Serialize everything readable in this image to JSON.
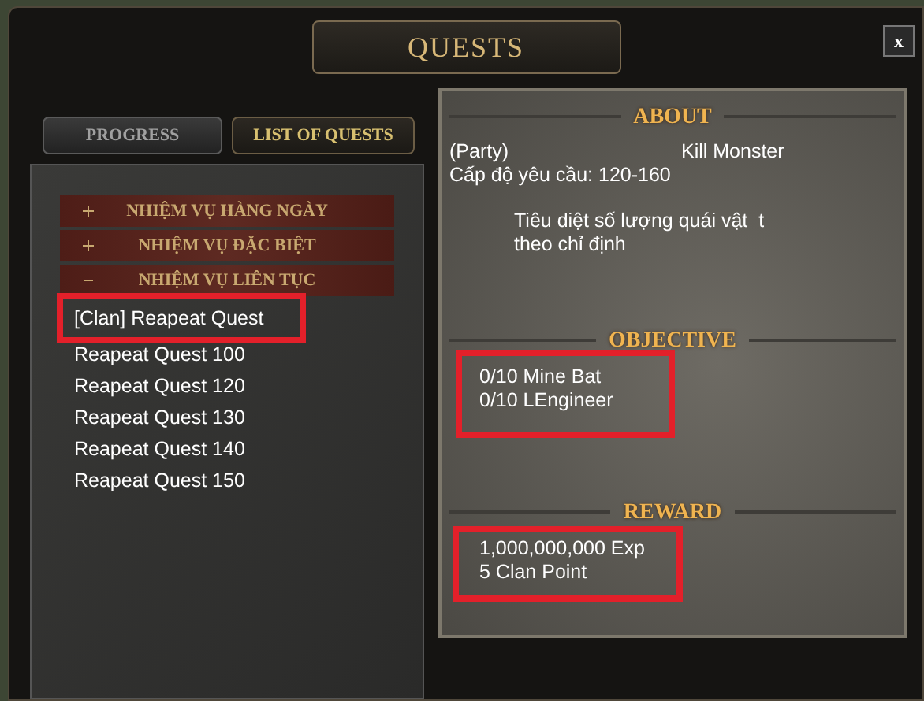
{
  "window": {
    "title": "QUESTS",
    "close_label": "x"
  },
  "tabs": [
    {
      "label": "PROGRESS",
      "selected": false
    },
    {
      "label": "LIST OF QUESTS",
      "selected": true
    }
  ],
  "quest_tree": [
    {
      "label": "NHIỆM VỤ HÀNG NGÀY",
      "expanded": false
    },
    {
      "label": "NHIỆM VỤ ĐẶC BIỆT",
      "expanded": false
    },
    {
      "label": "NHIỆM VỤ LIÊN TỤC",
      "expanded": true,
      "children": [
        {
          "label": "[Clan] Reapeat Quest",
          "highlighted": true
        },
        {
          "label": "Reapeat Quest 100",
          "highlighted": false
        },
        {
          "label": "Reapeat Quest 120",
          "highlighted": false
        },
        {
          "label": "Reapeat Quest 130",
          "highlighted": false
        },
        {
          "label": "Reapeat Quest 140",
          "highlighted": false
        },
        {
          "label": "Reapeat Quest 150",
          "highlighted": false
        }
      ]
    }
  ],
  "details": {
    "about": {
      "heading": "ABOUT",
      "party": "(Party)",
      "quest_type": "Kill Monster",
      "level_requirement": "Cấp độ yêu cầu: 120-160",
      "description": [
        "Tiêu diệt số lượng quái vật  t",
        "theo chỉ định"
      ]
    },
    "objective": {
      "heading": "OBJECTIVE",
      "highlighted": true,
      "lines": [
        "0/10 Mine Bat",
        "0/10 LEngineer"
      ]
    },
    "reward": {
      "heading": "REWARD",
      "highlighted": true,
      "lines": [
        "1,000,000,000 Exp",
        "5 Clan Point"
      ]
    }
  }
}
